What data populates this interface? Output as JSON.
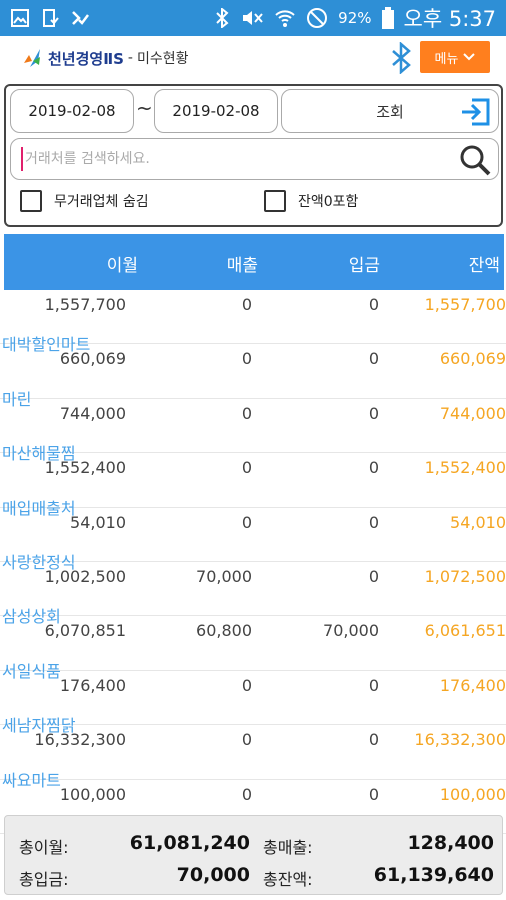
{
  "statusbar": {
    "battery": "92%",
    "time": "오후 5:37"
  },
  "header": {
    "brand": "천년경영ⅡS",
    "separator": "-",
    "title": "미수현황",
    "menu_label": "메뉴"
  },
  "filter": {
    "date_from": "2019-02-08",
    "tilde": "~",
    "date_to": "2019-02-08",
    "query_label": "조회",
    "search_placeholder": "거래처를 검색하세요.",
    "check_hide_no_trade": "무거래업체 숨김",
    "check_include_zero": "잔액0포함"
  },
  "table": {
    "headers": [
      "이월",
      "매출",
      "입금",
      "잔액"
    ],
    "rows": [
      {
        "name": "",
        "carry": "1,557,700",
        "sales": "0",
        "deposit": "0",
        "balance": "1,557,700"
      },
      {
        "name": "대박할인마트",
        "carry": "660,069",
        "sales": "0",
        "deposit": "0",
        "balance": "660,069"
      },
      {
        "name": "마린",
        "carry": "744,000",
        "sales": "0",
        "deposit": "0",
        "balance": "744,000"
      },
      {
        "name": "마산해물찜",
        "carry": "1,552,400",
        "sales": "0",
        "deposit": "0",
        "balance": "1,552,400"
      },
      {
        "name": "매입매출처",
        "carry": "54,010",
        "sales": "0",
        "deposit": "0",
        "balance": "54,010"
      },
      {
        "name": "사랑한정식",
        "carry": "1,002,500",
        "sales": "70,000",
        "deposit": "0",
        "balance": "1,072,500"
      },
      {
        "name": "삼성상회",
        "carry": "6,070,851",
        "sales": "60,800",
        "deposit": "70,000",
        "balance": "6,061,651"
      },
      {
        "name": "서일식품",
        "carry": "176,400",
        "sales": "0",
        "deposit": "0",
        "balance": "176,400"
      },
      {
        "name": "세남자찜닭",
        "carry": "16,332,300",
        "sales": "0",
        "deposit": "0",
        "balance": "16,332,300"
      },
      {
        "name": "싸요마트",
        "carry": "100,000",
        "sales": "0",
        "deposit": "0",
        "balance": "100,000"
      }
    ]
  },
  "totals": {
    "carry_label": "총이월:",
    "carry_value": "61,081,240",
    "sales_label": "총매출:",
    "sales_value": "128,400",
    "deposit_label": "총입금:",
    "deposit_value": "70,000",
    "balance_label": "총잔액:",
    "balance_value": "61,139,640"
  },
  "colors": {
    "statusbar": "#2e8fd6",
    "table_header": "#3b94e6",
    "menu_button": "#ff7f1e",
    "name_text": "#4ba3e8",
    "balance_text": "#f5a623"
  }
}
